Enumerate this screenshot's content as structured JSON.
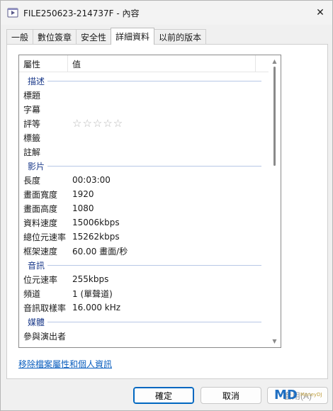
{
  "window": {
    "title": "FILE250623-214737F - 內容",
    "close_glyph": "✕"
  },
  "tabs": [
    {
      "label": "一般"
    },
    {
      "label": "數位簽章"
    },
    {
      "label": "安全性"
    },
    {
      "label": "詳細資料",
      "active": true
    },
    {
      "label": "以前的版本"
    }
  ],
  "list": {
    "header": {
      "property": "屬性",
      "value": "值"
    },
    "groups": {
      "description": {
        "title": "描述",
        "rows": [
          {
            "k": "標題",
            "v": ""
          },
          {
            "k": "字幕",
            "v": ""
          },
          {
            "k": "評等",
            "v": "☆☆☆☆☆"
          },
          {
            "k": "標籤",
            "v": ""
          },
          {
            "k": "註解",
            "v": ""
          }
        ]
      },
      "video": {
        "title": "影片",
        "rows": [
          {
            "k": "長度",
            "v": "00:03:00"
          },
          {
            "k": "畫面寬度",
            "v": "1920"
          },
          {
            "k": "畫面高度",
            "v": "1080"
          },
          {
            "k": "資料速度",
            "v": "15006kbps"
          },
          {
            "k": "總位元速率",
            "v": "15262kbps"
          },
          {
            "k": "框架速度",
            "v": "60.00 畫面/秒"
          }
        ]
      },
      "audio": {
        "title": "音訊",
        "rows": [
          {
            "k": "位元速率",
            "v": "255kbps"
          },
          {
            "k": "頻道",
            "v": "1 (單聲道)"
          },
          {
            "k": "音訊取樣率",
            "v": "16.000 kHz"
          }
        ]
      },
      "media": {
        "title": "媒體",
        "rows": [
          {
            "k": "參與演出者",
            "v": ""
          }
        ]
      }
    },
    "rating_stars": 0
  },
  "remove_link": "移除檔案屬性和個人資訊",
  "buttons": {
    "ok": "確定",
    "cancel": "取消",
    "apply": "套用(A)"
  },
  "watermark": {
    "logo": "MD",
    "text": "MoneyDJ"
  },
  "colors": {
    "accent": "#0067c0",
    "link": "#0b5fbf",
    "group_title": "#1b3a8a"
  }
}
